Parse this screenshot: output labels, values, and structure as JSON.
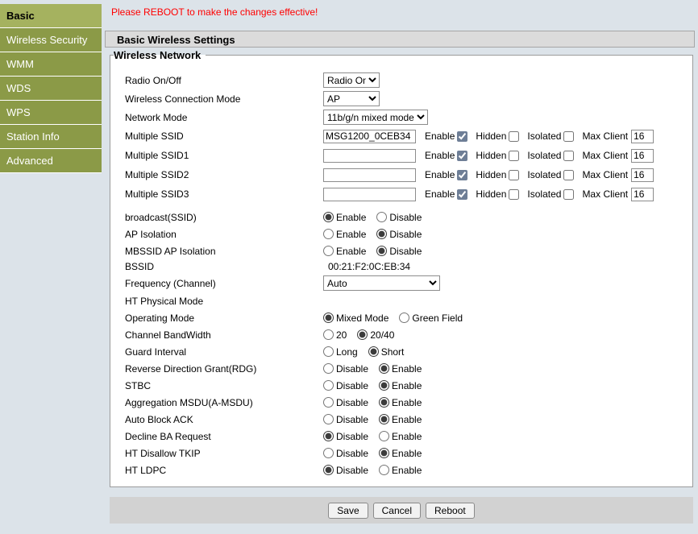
{
  "sidebar": {
    "items": [
      {
        "label": "Basic",
        "selected": true
      },
      {
        "label": "Wireless Security",
        "selected": false
      },
      {
        "label": "WMM",
        "selected": false
      },
      {
        "label": "WDS",
        "selected": false
      },
      {
        "label": "WPS",
        "selected": false
      },
      {
        "label": "Station Info",
        "selected": false
      },
      {
        "label": "Advanced",
        "selected": false
      }
    ]
  },
  "page": {
    "warning": "Please REBOOT to make the changes effective!",
    "section_title": "Basic Wireless Settings",
    "group_legend": "Wireless Network"
  },
  "select_rows": [
    {
      "label": "Radio On/Off",
      "value": "Radio On"
    },
    {
      "label": "Wireless Connection Mode",
      "value": "AP"
    },
    {
      "label": "Network Mode",
      "value": "11b/g/n mixed mode"
    }
  ],
  "ssid_labels": {
    "enable": "Enable",
    "hidden": "Hidden",
    "isolated": "Isolated",
    "max_client": "Max Client"
  },
  "ssid_rows": [
    {
      "label": "Multiple SSID",
      "value": "MSG1200_0CEB34",
      "enable": true,
      "hidden": false,
      "isolated": false,
      "max_client": "16"
    },
    {
      "label": "Multiple SSID1",
      "value": "",
      "enable": true,
      "hidden": false,
      "isolated": false,
      "max_client": "16"
    },
    {
      "label": "Multiple SSID2",
      "value": "",
      "enable": true,
      "hidden": false,
      "isolated": false,
      "max_client": "16"
    },
    {
      "label": "Multiple SSID3",
      "value": "",
      "enable": true,
      "hidden": false,
      "isolated": false,
      "max_client": "16"
    }
  ],
  "radio_rows": [
    {
      "label": "broadcast(SSID)",
      "options": [
        {
          "text": "Enable",
          "selected": true
        },
        {
          "text": "Disable",
          "selected": false
        }
      ]
    },
    {
      "label": "AP Isolation",
      "options": [
        {
          "text": "Enable",
          "selected": false
        },
        {
          "text": "Disable",
          "selected": true
        }
      ]
    },
    {
      "label": "MBSSID AP Isolation",
      "options": [
        {
          "text": "Enable",
          "selected": false
        },
        {
          "text": "Disable",
          "selected": true
        }
      ]
    }
  ],
  "bssid": {
    "label": "BSSID",
    "value": "00:21:F2:0C:EB:34"
  },
  "frequency": {
    "label": "Frequency (Channel)",
    "value": "Auto"
  },
  "ht_section_label": "HT Physical Mode",
  "ht_rows": [
    {
      "label": "Operating Mode",
      "options": [
        {
          "text": "Mixed Mode",
          "selected": true
        },
        {
          "text": "Green Field",
          "selected": false
        }
      ]
    },
    {
      "label": "Channel BandWidth",
      "options": [
        {
          "text": "20",
          "selected": false
        },
        {
          "text": "20/40",
          "selected": true
        }
      ]
    },
    {
      "label": "Guard Interval",
      "options": [
        {
          "text": "Long",
          "selected": false
        },
        {
          "text": "Short",
          "selected": true
        }
      ]
    },
    {
      "label": "Reverse Direction Grant(RDG)",
      "options": [
        {
          "text": "Disable",
          "selected": false
        },
        {
          "text": "Enable",
          "selected": true
        }
      ]
    },
    {
      "label": "STBC",
      "options": [
        {
          "text": "Disable",
          "selected": false
        },
        {
          "text": "Enable",
          "selected": true
        }
      ]
    },
    {
      "label": "Aggregation MSDU(A-MSDU)",
      "options": [
        {
          "text": "Disable",
          "selected": false
        },
        {
          "text": "Enable",
          "selected": true
        }
      ]
    },
    {
      "label": "Auto Block ACK",
      "options": [
        {
          "text": "Disable",
          "selected": false
        },
        {
          "text": "Enable",
          "selected": true
        }
      ]
    },
    {
      "label": "Decline BA Request",
      "options": [
        {
          "text": "Disable",
          "selected": true
        },
        {
          "text": "Enable",
          "selected": false
        }
      ]
    },
    {
      "label": "HT Disallow TKIP",
      "options": [
        {
          "text": "Disable",
          "selected": false
        },
        {
          "text": "Enable",
          "selected": true
        }
      ]
    },
    {
      "label": "HT LDPC",
      "options": [
        {
          "text": "Disable",
          "selected": true
        },
        {
          "text": "Enable",
          "selected": false
        }
      ]
    }
  ],
  "footer": {
    "save": "Save",
    "cancel": "Cancel",
    "reboot": "Reboot"
  },
  "colors": {
    "sidebar": "#8b9a47",
    "sidebar_selected": "#a5b25f",
    "page_bg": "#dce3e9",
    "warning_text": "#ff0000",
    "title_bar_bg": "#dbdbdb",
    "footer_bar_bg": "#d2d2d2"
  }
}
